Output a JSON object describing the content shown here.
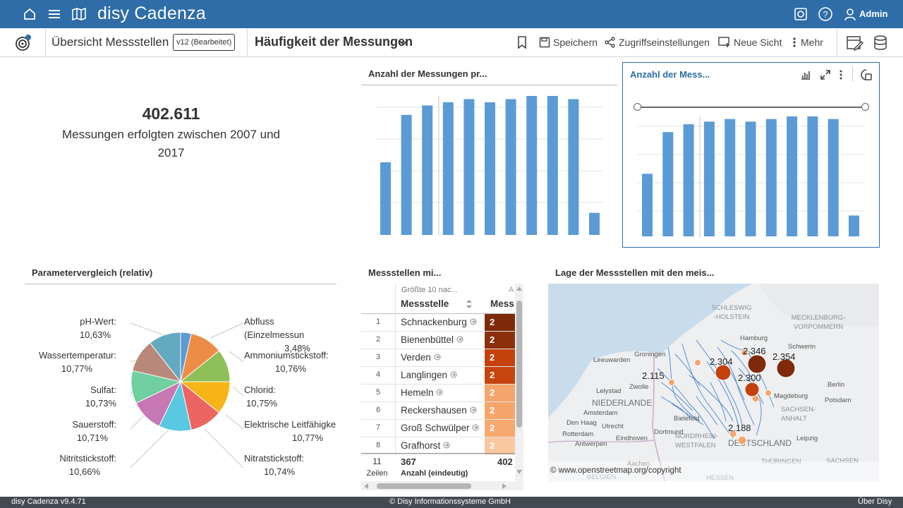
{
  "topbar": {
    "brand": "disy Cadenza",
    "user": "Admin",
    "color": "#2e6da8"
  },
  "subbar": {
    "workspace": "Übersicht Messstellen",
    "version": "v12 (Bearbeitet)",
    "view": "Häufigkeit der Messungen",
    "save": "Speichern",
    "access": "Zugriffseinstellungen",
    "new_view": "Neue Sicht",
    "more": "Mehr"
  },
  "kpi": {
    "value": "402.611",
    "text": "Messungen erfolgten zwischen 2007 und 2017"
  },
  "bar_left": {
    "title": "Anzahl der Messungen pr..."
  },
  "bar_right": {
    "title": "Anzahl der Mess..."
  },
  "chart_data": [
    {
      "type": "bar",
      "title": "Anzahl der Messungen pr...",
      "values": [
        23,
        38,
        41,
        42,
        43,
        42,
        43,
        44,
        44,
        43,
        7
      ]
    },
    {
      "type": "bar",
      "title": "Anzahl der Mess...",
      "values": [
        24,
        40,
        43,
        44,
        45,
        44,
        45,
        46,
        46,
        45,
        8
      ]
    },
    {
      "type": "pie",
      "title": "Parametervergleich (relativ)",
      "slices": [
        {
          "label": "Abfluss (Einzelmessun",
          "value": "3,48%",
          "pct": 3.48,
          "color": "#5b9bd5"
        },
        {
          "label": "Ammoniumstickstoff:",
          "value": "10,76%",
          "pct": 10.76,
          "color": "#ed8c47"
        },
        {
          "label": "Chlorid:",
          "value": "10,75%",
          "pct": 10.75,
          "color": "#8fbf57"
        },
        {
          "label": "Elektrische Leitfähigke",
          "value": "10,77%",
          "pct": 10.77,
          "color": "#f7b416"
        },
        {
          "label": "Nitratstickstoff:",
          "value": "10,74%",
          "pct": 10.74,
          "color": "#ec6562"
        },
        {
          "label": "Nitritstickstoff:",
          "value": "10,66%",
          "pct": 10.66,
          "color": "#5ac8e0"
        },
        {
          "label": "Sauerstoff:",
          "value": "10,71%",
          "pct": 10.71,
          "color": "#c677b4"
        },
        {
          "label": "Sulfat:",
          "value": "10,73%",
          "pct": 10.73,
          "color": "#6fcf9e"
        },
        {
          "label": "Wassertemperatur:",
          "value": "10,77%",
          "pct": 10.77,
          "color": "#b8897a"
        },
        {
          "label": "pH-Wert:",
          "value": "10,63%",
          "pct": 10.63,
          "color": "#63a9c0"
        }
      ]
    }
  ],
  "table": {
    "title": "Messstellen mi...",
    "subheader": "Größte 10 nac...",
    "subheader2": "A",
    "col1": "Messstelle",
    "col2": "Mess",
    "rows": [
      {
        "num": "1",
        "name": "Schnackenburg",
        "color": "#7f2a0a",
        "val": "2"
      },
      {
        "num": "2",
        "name": "Bienenbüttel",
        "color": "#8b2f0c",
        "val": "2"
      },
      {
        "num": "3",
        "name": "Verden",
        "color": "#c4410c",
        "val": "2"
      },
      {
        "num": "4",
        "name": "Langlingen",
        "color": "#c8440f",
        "val": "2"
      },
      {
        "num": "5",
        "name": "Hemeln",
        "color": "#f4a46c",
        "val": "2"
      },
      {
        "num": "6",
        "name": "Reckershausen",
        "color": "#f6a56b",
        "val": "2"
      },
      {
        "num": "7",
        "name": "Groß Schwülper",
        "color": "#f7a86e",
        "val": "2"
      },
      {
        "num": "8",
        "name": "Grafhorst",
        "color": "#f9c7a0",
        "val": "2"
      }
    ],
    "footer_count": "11",
    "footer_rows": "Zeilen",
    "footer_value": "367",
    "footer_label": "Anzahl (eindeutig)",
    "footer_value2": "402"
  },
  "map": {
    "title": "Lage der Messstellen mit den meis...",
    "copyright": "© www.openstreetmap.org/copyright",
    "regions": [
      "SCHLESWIG-HOLSTEIN",
      "MECKLENBURG-VORPOMMERN",
      "NIEDERLANDE",
      "SACHSEN-ANHALT",
      "NORDRHEIN-WESTFALEN",
      "DEUTSCHLAND",
      "BELGIEN",
      "THÜRINGEN",
      "SACHSEN",
      "HESSEN"
    ],
    "cities": [
      "Hamburg",
      "Schwerin",
      "Groningen",
      "Leeuwarden",
      "Zwolle",
      "Lelystad",
      "Berlin",
      "Potsdam",
      "Amsterdam",
      "Utrecht",
      "Antwerpen",
      "Eindhoven",
      "Leipzig",
      "Bielefeld",
      "Den Haag",
      "Dortmund",
      "Aachen",
      "Rotterdam",
      "Magdeburg"
    ],
    "labels": [
      "2.346",
      "2.354",
      "2.304",
      "2.115",
      "2.300",
      "2.188"
    ]
  },
  "footer": {
    "version": "disy Cadenza v9.4.71",
    "copyright": "© Disy Informationssysteme GmbH",
    "about": "Über Disy"
  }
}
